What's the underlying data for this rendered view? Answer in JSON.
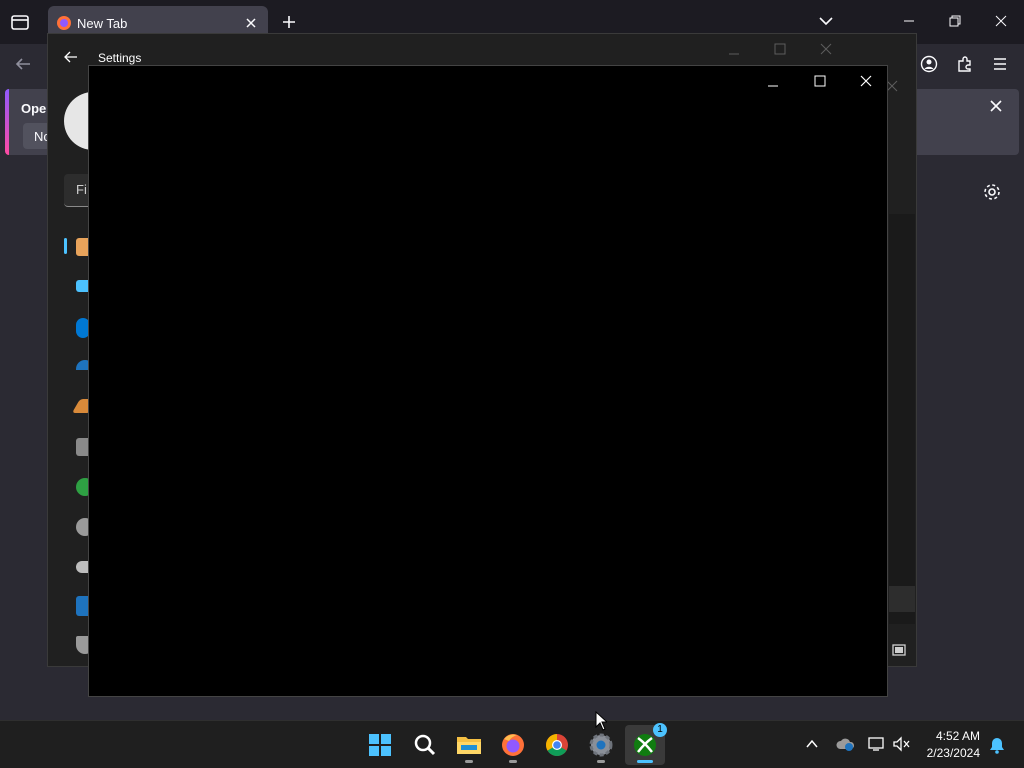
{
  "browser": {
    "tab_title": "New Tab",
    "notification_title": "Oper",
    "notification_button": "No"
  },
  "settings": {
    "title": "Settings",
    "find_placeholder": "Fi"
  },
  "taskbar": {
    "time": "4:52 AM",
    "date": "2/23/2024",
    "xbox_badge": "1"
  },
  "colors": {
    "accent": "#4cc2ff",
    "firefox_purple": "#9059ff"
  }
}
